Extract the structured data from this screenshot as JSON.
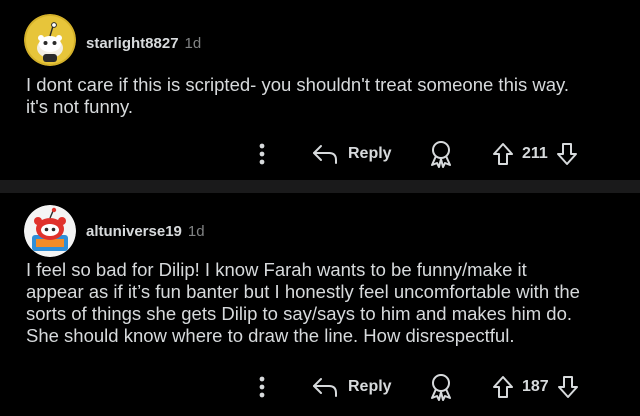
{
  "comments": [
    {
      "username": "starlight8827",
      "age": "1d",
      "body_lines": [
        "I dont care if this is scripted- you shouldn't treat someone this way.",
        "it's not funny."
      ],
      "actions": {
        "reply_label": "Reply",
        "score": "211"
      },
      "avatar": "snoo-avatar-yellow"
    },
    {
      "username": "altuniverse19",
      "age": "1d",
      "body_lines": [
        "I feel so bad for Dilip! I know Farah wants to be funny/make it",
        "appear as if it’s fun banter but I honestly feel uncomfortable with the",
        "sorts of things she gets Dilip to say/says to him and makes him do.",
        "She should know where to draw the line. How disrespectful."
      ],
      "actions": {
        "reply_label": "Reply",
        "score": "187"
      },
      "avatar": "snoo-avatar-red-ruins"
    }
  ],
  "icons": {
    "more": "more-vertical-icon",
    "reply": "reply-arrow-icon",
    "award": "award-icon",
    "upvote": "upvote-arrow-icon",
    "downvote": "downvote-arrow-icon"
  },
  "colors": {
    "background": "#000000",
    "divider": "#1a1a1b",
    "text": "#d7dadc",
    "meta": "#818384"
  }
}
